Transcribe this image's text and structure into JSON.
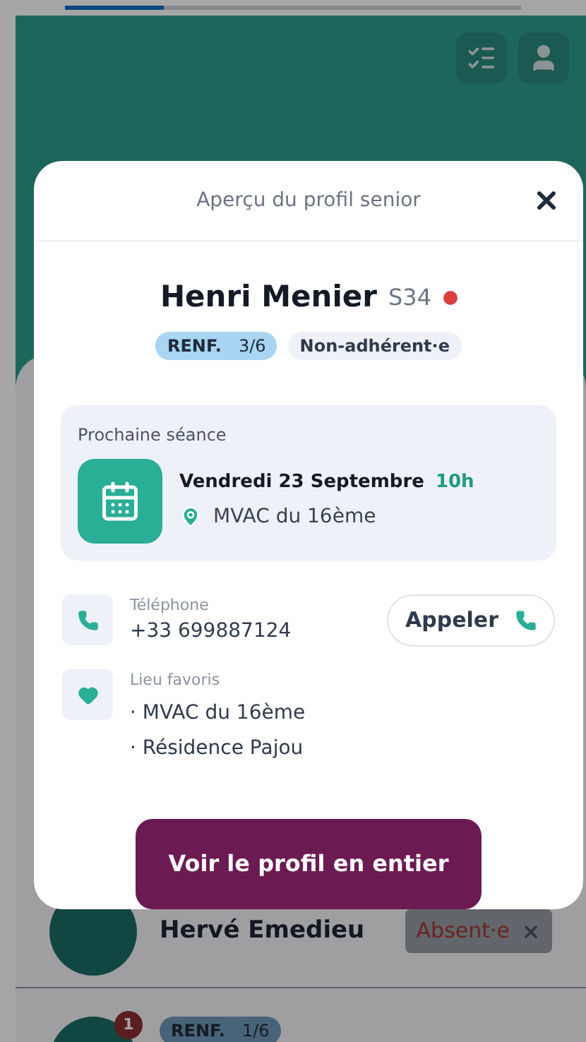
{
  "background_list": {
    "rows": [
      {
        "kind": "absent",
        "name": "Hervé Emedieu",
        "status": "Absent·e"
      },
      {
        "kind": "program",
        "badge_count": "1",
        "tag": "RENF.",
        "progress": "1/6"
      }
    ]
  },
  "modal": {
    "title": "Aperçu du profil senior",
    "name": "Henri Menier",
    "code": "S34",
    "alert": true,
    "tags": [
      {
        "kind": "program",
        "label": "RENF.",
        "value": "3/6"
      },
      {
        "kind": "membership",
        "label": "Non-adhérent·e"
      }
    ],
    "next_session": {
      "label": "Prochaine séance",
      "date": "Vendredi 23 Septembre",
      "time": "10h",
      "place": "MVAC du 16ème"
    },
    "phone": {
      "label": "Téléphone",
      "value": "+33 699887124",
      "button": "Appeler"
    },
    "favorites": {
      "label": "Lieu favoris",
      "items": [
        "· MVAC du 16ème",
        "· Résidence Pajou"
      ]
    },
    "cta": "Voir le profil en entier"
  }
}
